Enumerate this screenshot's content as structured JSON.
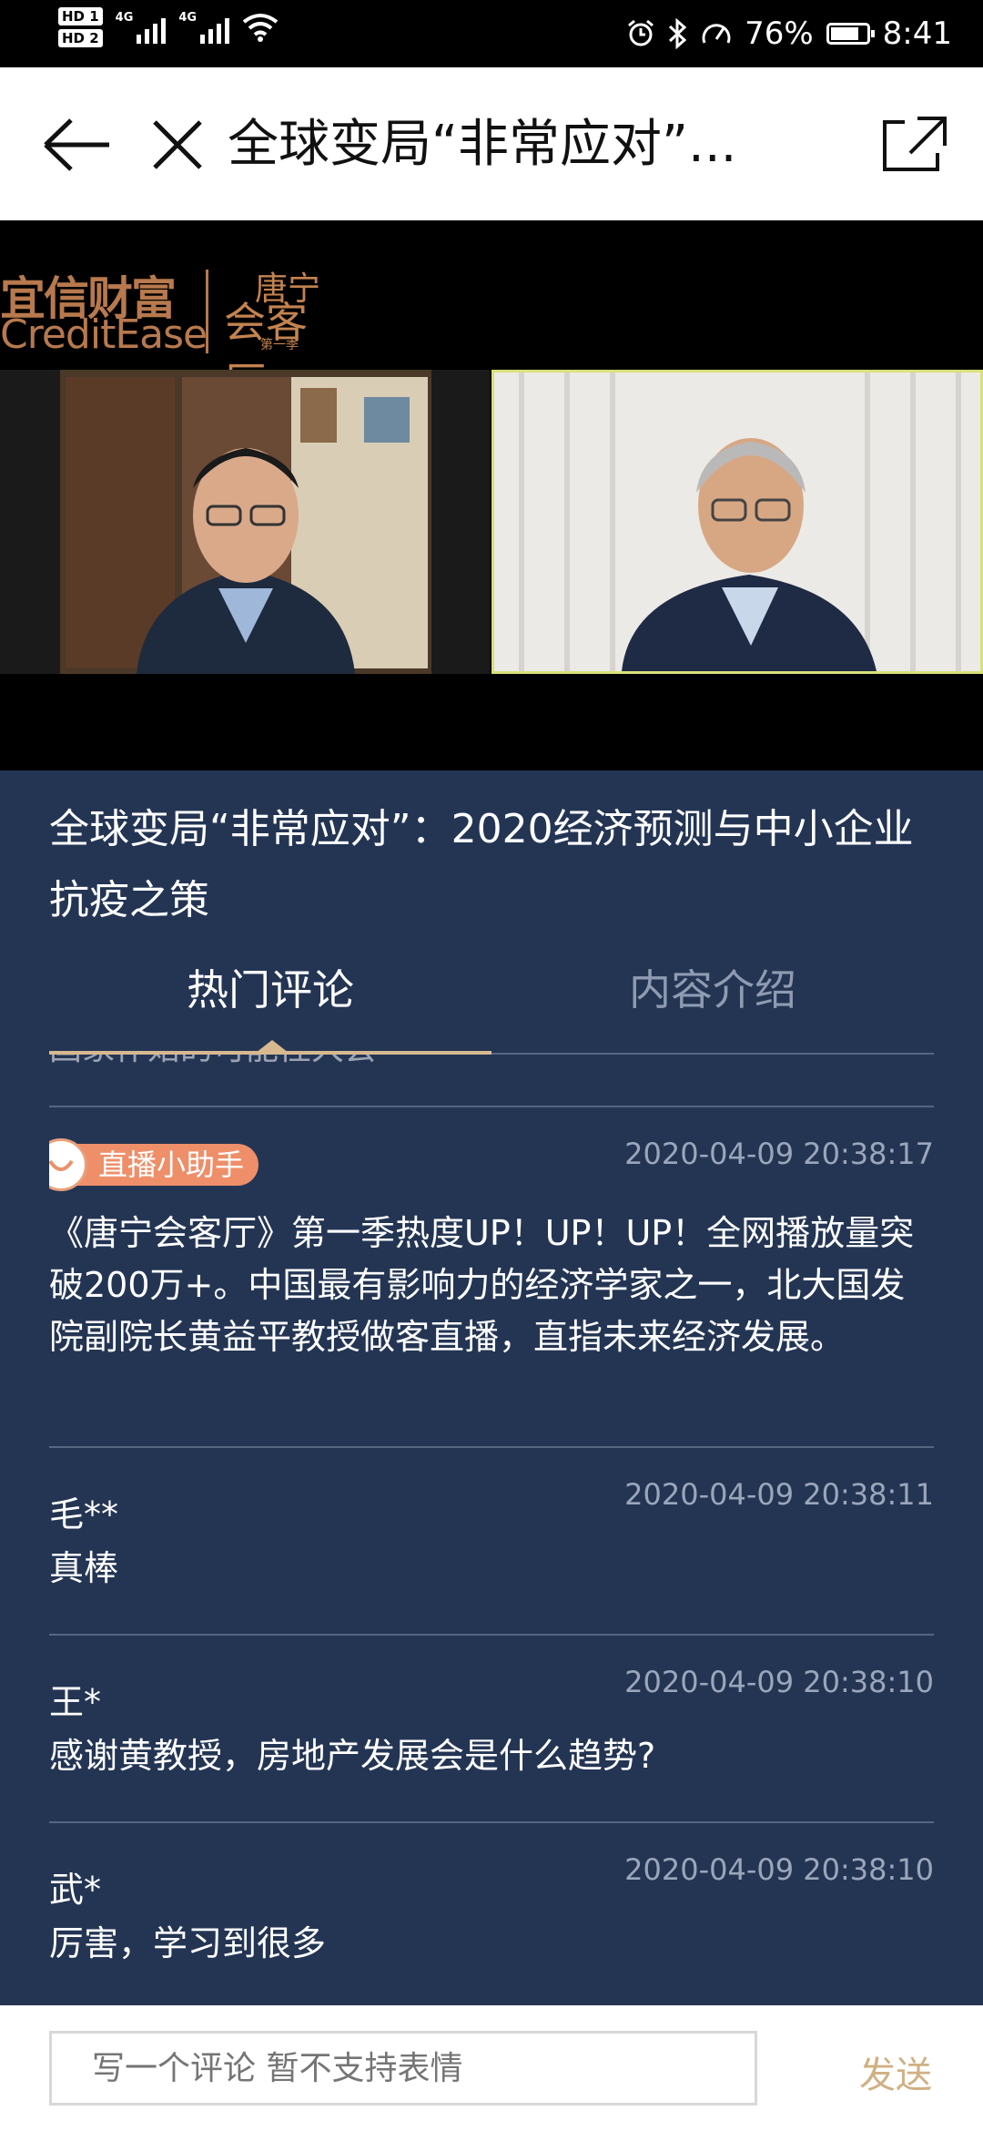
{
  "status_bar": {
    "hd1": "HD 1",
    "hd2": "HD 2",
    "signal1_label": "4G",
    "signal2_label": "4G",
    "battery": "76%",
    "time": "8:41"
  },
  "nav": {
    "title": "全球变局“非常应对”..."
  },
  "video": {
    "brand_cn": "宜信财富",
    "brand_en": "CreditEase",
    "show_name_top": "唐宁",
    "show_name_bottom": "会客厅",
    "season": "第一季"
  },
  "program": {
    "title": "全球变局“非常应对”：2020经济预测与中小企业抗疫之策"
  },
  "tabs": [
    {
      "label": "热门评论",
      "active": true
    },
    {
      "label": "内容介绍",
      "active": false
    }
  ],
  "comments": {
    "cut_text": "国家作始的可能性大会",
    "items": [
      {
        "name": "直播小助手",
        "time": "2020-04-09 20:38:17",
        "text": "《唐宁会客厅》第一季热度UP！UP！UP！全网播放量突破200万+。中国最有影响力的经济学家之一，北大国发院副院长黄益平教授做客直播，直指未来经济发展。"
      },
      {
        "name": "毛**",
        "time": "2020-04-09 20:38:11",
        "text": "真棒"
      },
      {
        "name": "王*",
        "time": "2020-04-09 20:38:10",
        "text": "感谢黄教授，房地产发展会是什么趋势?"
      },
      {
        "name": "武*",
        "time": "2020-04-09 20:38:10",
        "text": "厉害，学习到很多"
      }
    ]
  },
  "composer": {
    "placeholder": "写一个评论 暂不支持表情",
    "send_label": "发送"
  },
  "colors": {
    "panel_bg": "#243554",
    "accent_gold": "#d7b98f",
    "badge_orange": "#ee8f6a",
    "brand_bronze": "#b7794d"
  }
}
